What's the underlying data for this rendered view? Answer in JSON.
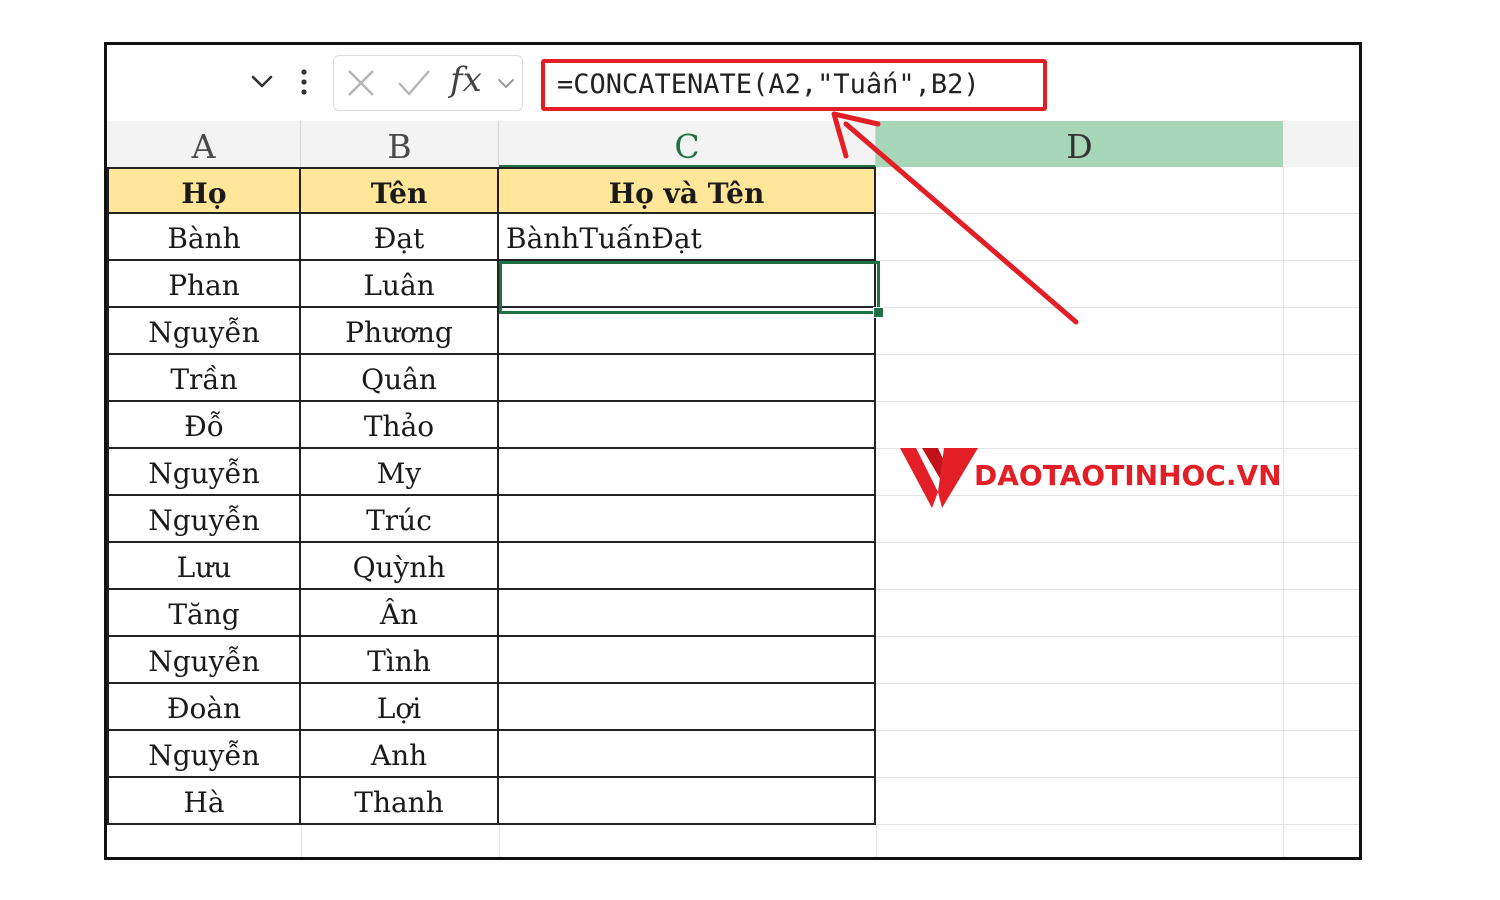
{
  "formula_bar": {
    "name_box": "",
    "fx_label": "fx",
    "formula": "=CONCATENATE(A2,\"Tuấn\",B2)"
  },
  "columns": [
    "A",
    "B",
    "C",
    "D"
  ],
  "header_row": {
    "a": "Họ",
    "b": "Tên",
    "c": "Họ và Tên"
  },
  "rows": [
    {
      "a": "Bành",
      "b": "Đạt",
      "c": "BànhTuấnĐạt"
    },
    {
      "a": "Phan",
      "b": "Luân",
      "c": ""
    },
    {
      "a": "Nguyễn",
      "b": "Phương",
      "c": ""
    },
    {
      "a": "Trần",
      "b": "Quân",
      "c": ""
    },
    {
      "a": "Đỗ",
      "b": "Thảo",
      "c": ""
    },
    {
      "a": "Nguyễn",
      "b": "My",
      "c": ""
    },
    {
      "a": "Nguyễn",
      "b": "Trúc",
      "c": ""
    },
    {
      "a": "Lưu",
      "b": "Quỳnh",
      "c": ""
    },
    {
      "a": "Tăng",
      "b": "Ân",
      "c": ""
    },
    {
      "a": "Nguyễn",
      "b": "Tình",
      "c": ""
    },
    {
      "a": "Đoàn",
      "b": "Lợi",
      "c": ""
    },
    {
      "a": "Nguyễn",
      "b": "Anh",
      "c": ""
    },
    {
      "a": "Hà",
      "b": "Thanh",
      "c": ""
    }
  ],
  "selected_cell": "C2",
  "logo": {
    "text": "DAOTAOTINHOC.VN"
  },
  "colors": {
    "header_fill": "#ffe699",
    "selected_column_header": "#a7d7b8",
    "selection_border": "#1e7145",
    "highlight_red": "#e21f26"
  },
  "icons": {
    "namebox_dropdown": "chevron-down-icon",
    "more": "vertical-dots-icon",
    "cancel": "x-icon",
    "enter": "check-icon",
    "function": "fx-icon"
  }
}
